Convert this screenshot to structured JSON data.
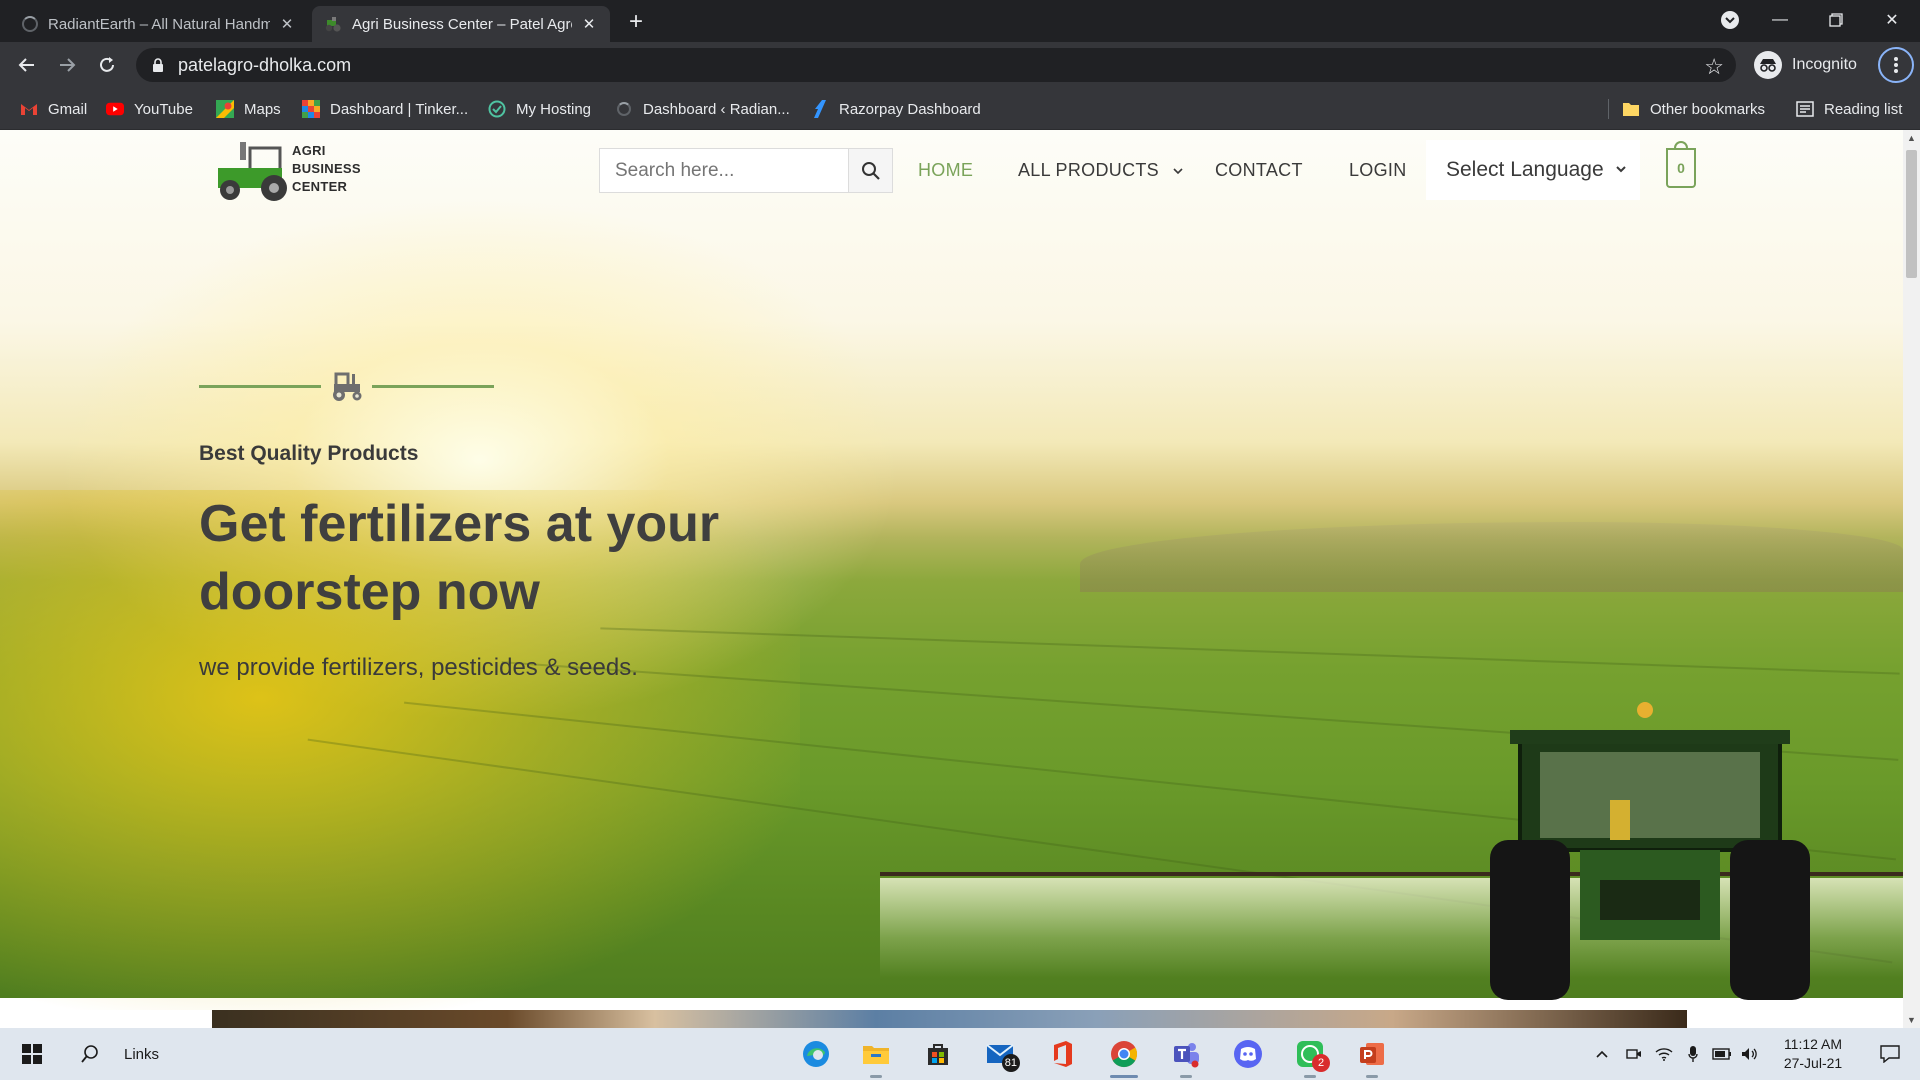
{
  "browser": {
    "tabs": [
      {
        "title": "RadiantEarth – All Natural Handmade",
        "active": false
      },
      {
        "title": "Agri Business Center – Patel Agro",
        "active": true
      }
    ],
    "url": "patelagro-dholka.com",
    "profile_label": "Incognito",
    "bookmarks": [
      {
        "label": "Gmail",
        "icon": "gmail-icon"
      },
      {
        "label": "YouTube",
        "icon": "youtube-icon"
      },
      {
        "label": "Maps",
        "icon": "maps-icon"
      },
      {
        "label": "Dashboard | Tinker...",
        "icon": "tinkercad-icon"
      },
      {
        "label": "My Hosting",
        "icon": "hosting-icon"
      },
      {
        "label": "Dashboard ‹ Radian...",
        "icon": "loading-icon"
      },
      {
        "label": "Razorpay Dashboard",
        "icon": "razorpay-icon"
      }
    ],
    "other_bookmarks": "Other bookmarks",
    "reading_list": "Reading list"
  },
  "site": {
    "logo_lines": [
      "AGRI",
      "BUSINESS",
      "CENTER"
    ],
    "search_placeholder": "Search here...",
    "nav": {
      "home": "HOME",
      "all_products": "ALL PRODUCTS",
      "contact": "CONTACT",
      "login": "LOGIN"
    },
    "language_select": "Select Language",
    "cart_count": "0",
    "accent_color": "#7aa35a"
  },
  "hero": {
    "tagline": "Best Quality Products",
    "title": "Get fertilizers at your doorstep now",
    "subtitle": "we provide fertilizers, pesticides & seeds."
  },
  "taskbar": {
    "links_label": "Links",
    "apps": [
      {
        "name": "edge",
        "badge": ""
      },
      {
        "name": "file-explorer",
        "badge": ""
      },
      {
        "name": "store",
        "badge": ""
      },
      {
        "name": "mail",
        "badge": "81"
      },
      {
        "name": "office",
        "badge": ""
      },
      {
        "name": "chrome",
        "badge": ""
      },
      {
        "name": "teams",
        "badge": ""
      },
      {
        "name": "discord",
        "badge": ""
      },
      {
        "name": "whatsapp",
        "badge": "2"
      },
      {
        "name": "powerpoint",
        "badge": ""
      }
    ],
    "time": "11:12 AM",
    "date": "27-Jul-21"
  }
}
